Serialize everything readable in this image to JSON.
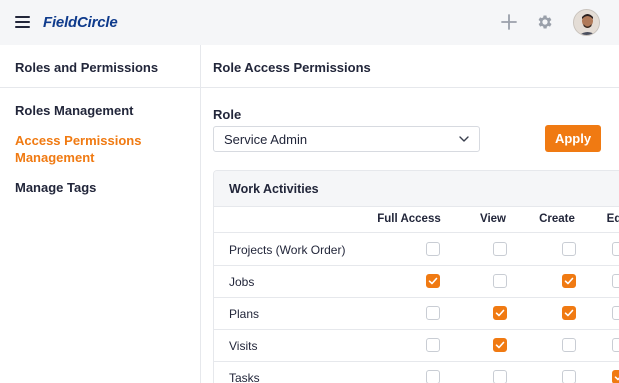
{
  "app": {
    "logo_text": "FieldCircle"
  },
  "topbar": {
    "icons": [
      "menu-icon",
      "plus-icon",
      "gear-icon",
      "avatar"
    ]
  },
  "sidebar": {
    "title": "Roles and Permissions",
    "items": [
      {
        "label": "Roles Management",
        "active": false
      },
      {
        "label": "Access Permissions Management",
        "active": true
      },
      {
        "label": "Manage Tags",
        "active": false
      }
    ]
  },
  "main": {
    "title": "Role Access Permissions",
    "role_label": "Role",
    "role_value": "Service Admin",
    "apply_label": "Apply",
    "panel": {
      "title": "Work Activities",
      "columns": [
        "Full Access",
        "View",
        "Create",
        "Ed"
      ],
      "rows": [
        {
          "name": "Projects (Work Order)",
          "checks": [
            false,
            false,
            false,
            false
          ]
        },
        {
          "name": "Jobs",
          "checks": [
            true,
            false,
            true,
            false
          ]
        },
        {
          "name": "Plans",
          "checks": [
            false,
            true,
            true,
            false
          ]
        },
        {
          "name": "Visits",
          "checks": [
            false,
            true,
            false,
            false
          ]
        },
        {
          "name": "Tasks",
          "checks": [
            false,
            false,
            false,
            true
          ]
        }
      ]
    }
  },
  "colors": {
    "accent": "#f07a12",
    "brand": "#0f3b8c",
    "text": "#22263a"
  }
}
